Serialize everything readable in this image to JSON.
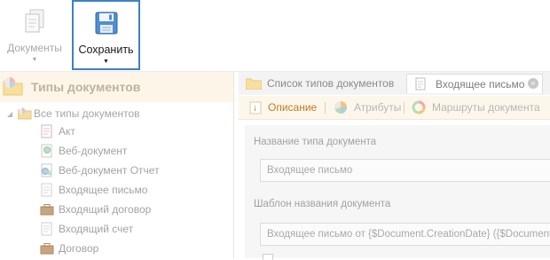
{
  "ribbon": {
    "documents_label": "Документы",
    "save_label": "Сохранить",
    "caret": "▼"
  },
  "tree": {
    "header_title": "Типы документов",
    "root_label": "Все типы документов",
    "items": [
      {
        "label": "Акт",
        "icon": "act-document-icon"
      },
      {
        "label": "Веб-документ",
        "icon": "web-document-icon"
      },
      {
        "label": "Веб-документ Отчет",
        "icon": "web-report-icon"
      },
      {
        "label": "Входящее письмо",
        "icon": "document-icon"
      },
      {
        "label": "Входящий договор",
        "icon": "briefcase-icon"
      },
      {
        "label": "Входящий счет",
        "icon": "document-icon"
      },
      {
        "label": "Договор",
        "icon": "briefcase-icon"
      }
    ]
  },
  "tabs": {
    "list_label": "Список типов документов",
    "active_label": "Входящее письмо",
    "close_glyph": "×"
  },
  "subtabs": {
    "description": "Описание",
    "attributes": "Атрибуты",
    "routes": "Маршруты документа"
  },
  "form": {
    "name_label": "Название типа документа",
    "name_value": "Входящее письмо",
    "template_label": "Шаблон названия документа",
    "template_value": "Входящее письмо от {$Document.CreationDate} ({$Document."
  },
  "colors": {
    "accent": "#3c82c6",
    "active_subtab": "#c17a26",
    "tree_header_bg": "#fdf6e8"
  }
}
